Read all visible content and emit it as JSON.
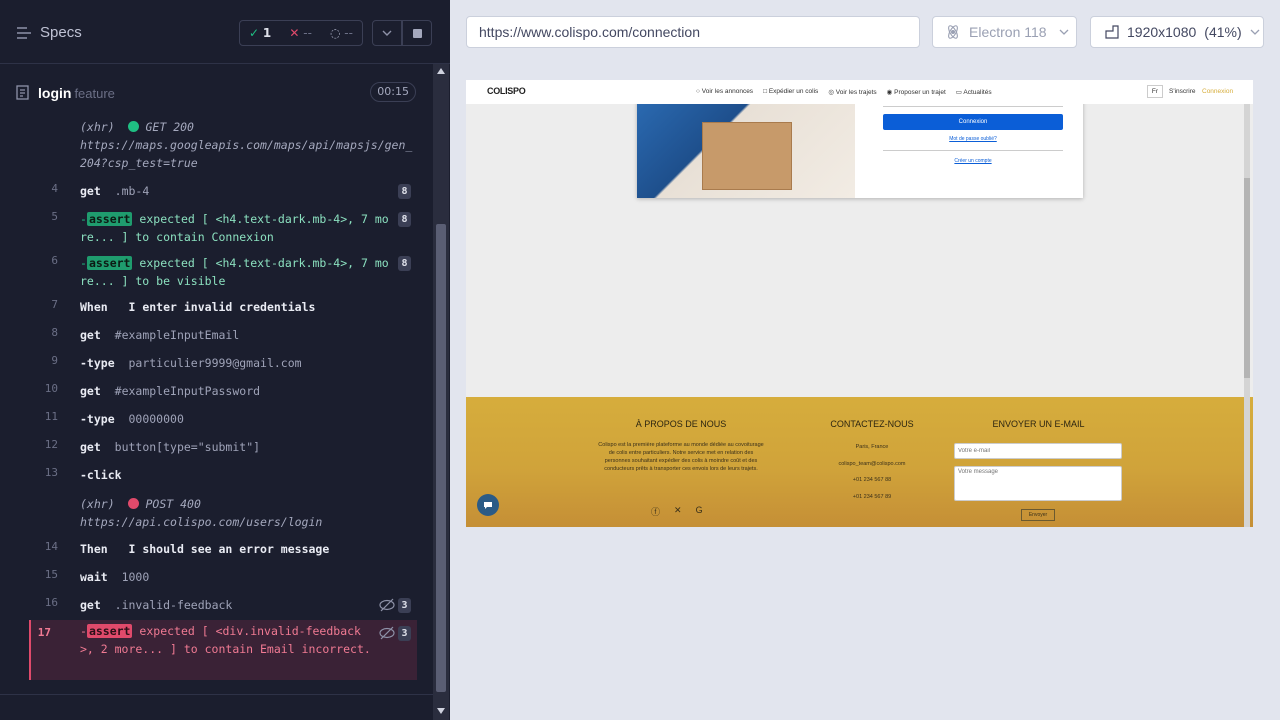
{
  "left": {
    "title": "Specs",
    "stats": {
      "passed": "1",
      "failed": "--",
      "pending": "--"
    },
    "file": {
      "name": "login",
      "ext": "feature",
      "time": "00:15"
    },
    "commands": [
      {
        "type": "xhr",
        "prefix": "(xhr)",
        "status": "GET 200",
        "url": "https://maps.googleapis.com/maps/api/mapsjs/gen_204?csp_test=true"
      },
      {
        "num": "4",
        "name": "get",
        "arg": ".mb-4",
        "badge": "8"
      },
      {
        "num": "5",
        "assert": "assert",
        "text": "expected [ <h4.text-dark.mb-4>, 7 more... ] to contain Connexion",
        "badge": "8"
      },
      {
        "num": "6",
        "assert": "assert",
        "text": "expected [ <h4.text-dark.mb-4>, 7 more... ] to be visible",
        "badge": "8"
      },
      {
        "num": "7",
        "name": "When",
        "arg": "I enter invalid credentials"
      },
      {
        "num": "8",
        "name": "get",
        "arg": "#exampleInputEmail"
      },
      {
        "num": "9",
        "name": "-type",
        "arg": "particulier9999@gmail.com"
      },
      {
        "num": "10",
        "name": "get",
        "arg": "#exampleInputPassword"
      },
      {
        "num": "11",
        "name": "-type",
        "arg": "00000000"
      },
      {
        "num": "12",
        "name": "get",
        "arg": "button[type=\"submit\"]"
      },
      {
        "num": "13",
        "name": "-click",
        "arg": ""
      },
      {
        "type": "xhr",
        "prefix": "(xhr)",
        "status": "POST 400",
        "url": "https://api.colispo.com/users/login"
      },
      {
        "num": "14",
        "name": "Then",
        "arg": "I should see an error message"
      },
      {
        "num": "15",
        "name": "wait",
        "arg": "1000"
      },
      {
        "num": "16",
        "name": "get",
        "arg": ".invalid-feedback",
        "badge": "3"
      },
      {
        "num": "17",
        "assert": "assert",
        "text": "expected [ <div.invalid-feedback>, 2 more... ] to contain Email incorrect.",
        "badge": "3"
      }
    ]
  },
  "right": {
    "url": "https://www.colispo.com/connection",
    "browser": "Electron 118",
    "viewport": "1920x1080",
    "zoom": "(41%)",
    "site": {
      "logo": "COLISPO",
      "nav": [
        "Voir les annonces",
        "Expédier un colis",
        "Voir les trajets",
        "Proposer un trajet",
        "Actualités"
      ],
      "lang": "Fr",
      "signup": "S'inscrire",
      "login": "Connexion",
      "form": {
        "button": "Connexion",
        "forgot": "Mot de passe oublié?",
        "create": "Créer un compte"
      },
      "footer": {
        "about_title": "À PROPOS DE NOUS",
        "about_text": "Colispo est la première plateforme au monde dédiée au covoiturage de colis entre particuliers. Notre service met en relation des personnes souhaitant expédier des colis à moindre coût et des conducteurs prêts à transporter ces envois lors de leurs trajets.",
        "contact_title": "CONTACTEZ-NOUS",
        "contact": [
          "Paris, France",
          "colispo_team@colispo.com",
          "+01 234 567 88",
          "+01 234 567 89"
        ],
        "email_title": "ENVOYER UN E-MAIL",
        "email_placeholder": "Votre e-mail",
        "message_placeholder": "Votre message",
        "send": "Envoyer"
      }
    }
  },
  "colors": {
    "bg": "#1b1e2e",
    "pass": "#1f9c6e",
    "fail": "#e04a6b",
    "brand": "#0b5ed7",
    "gold": "#d6ad3c"
  }
}
